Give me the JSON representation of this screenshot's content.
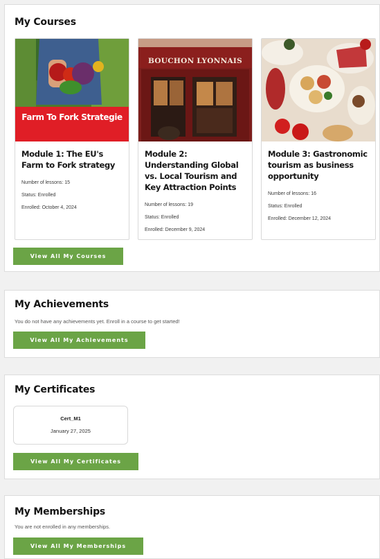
{
  "courses": {
    "title": "My Courses",
    "cards": [
      {
        "image_caption": "Farm To Fork Strategie",
        "title": "Module 1: The EU's Farm to Fork strategy",
        "lessons": "Number of lessons: 15",
        "status": "Status: Enrolled",
        "enrolled": "Enrolled: October 4, 2024"
      },
      {
        "image_caption": "BOUCHON LYONNAIS",
        "title": "Module 2: Understanding Global vs. Local Tourism and Key Attraction Points",
        "lessons": "Number of lessons: 19",
        "status": "Status: Enrolled",
        "enrolled": "Enrolled: December 9, 2024"
      },
      {
        "image_caption": "",
        "title": "Module 3: Gastronomic tourism as business opportunity",
        "lessons": "Number of lessons: 16",
        "status": "Status: Enrolled",
        "enrolled": "Enrolled: December 12, 2024"
      }
    ],
    "button_label": "View All My Courses"
  },
  "achievements": {
    "title": "My Achievements",
    "empty_text": "You do not have any achievements yet. Enroll in a course to get started!",
    "button_label": "View All My Achievements"
  },
  "certificates": {
    "title": "My Certificates",
    "items": [
      {
        "name": "Cert_M1",
        "date": "January 27, 2025"
      }
    ],
    "button_label": "View All My Certificates"
  },
  "memberships": {
    "title": "My Memberships",
    "empty_text": "You are not enrolled in any memberships.",
    "button_label": "View All My Memberships"
  },
  "colors": {
    "button_green": "#6ba446",
    "page_background": "#f1f1f1",
    "card_border": "#d8d8d8"
  }
}
